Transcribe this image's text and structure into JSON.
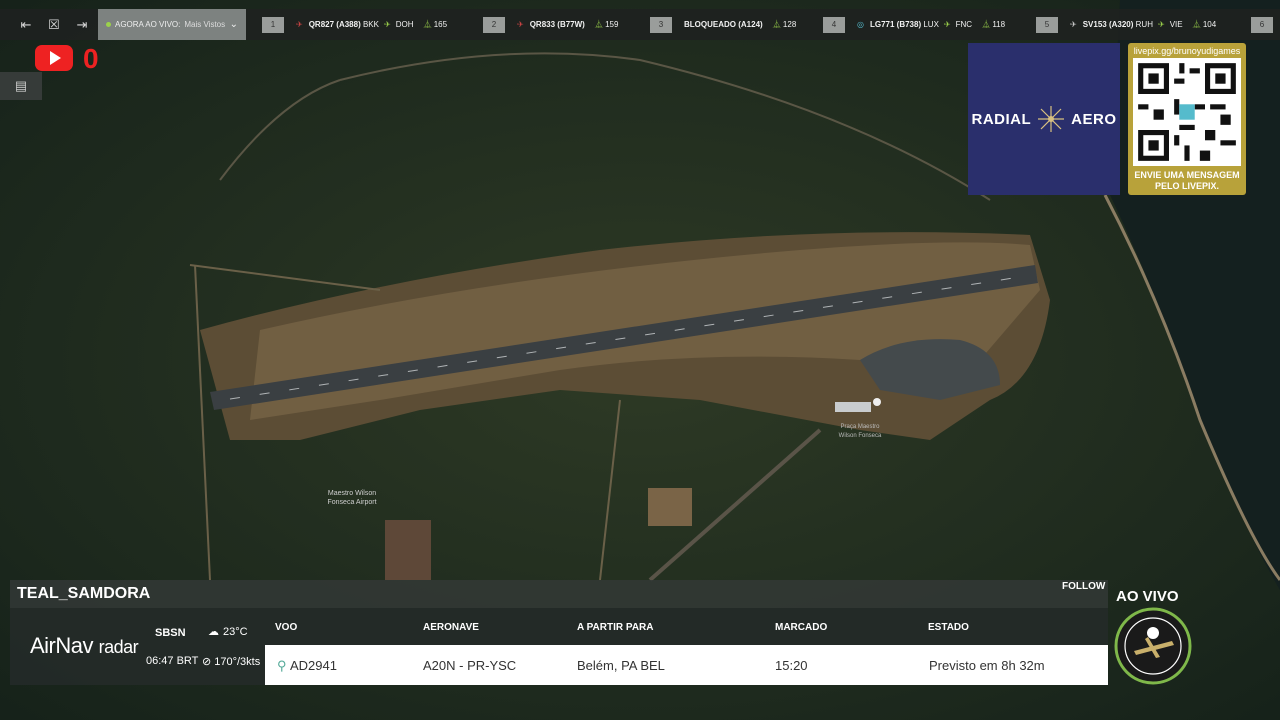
{
  "topbar": {
    "live_label": "AGORA AO VIVO:",
    "live_value": "Mais Vistos",
    "flights": [
      {
        "num": "1",
        "code": "QR827 (A388)",
        "from": "BKK",
        "to": "DOH",
        "count": "165"
      },
      {
        "num": "2",
        "code": "QR833 (B77W)",
        "from": "",
        "to": "",
        "count": "159"
      },
      {
        "num": "3",
        "code": "BLOQUEADO (A124)",
        "from": "",
        "to": "",
        "count": "128"
      },
      {
        "num": "4",
        "code": "LG771 (B738)",
        "from": "LUX",
        "to": "FNC",
        "count": "118"
      },
      {
        "num": "5",
        "code": "SV153 (A320)",
        "from": "RUH",
        "to": "VIE",
        "count": "104"
      },
      {
        "num": "6",
        "code": "",
        "from": "",
        "to": "",
        "count": ""
      }
    ]
  },
  "youtube": {
    "count": "0"
  },
  "sponsor": {
    "left": "RADIAL",
    "right": "AERO"
  },
  "qr": {
    "url": "livepix.gg/brunoyudigames",
    "message": "ENVIE UMA MENSAGEM PELO LIVEPIX."
  },
  "map_labels": {
    "airport": "Maestro Wilson Fonseca Airport",
    "plaza": "Praça Maestro Wilson Fonseca"
  },
  "panel": {
    "callsign": "TEAL_SAMDORA",
    "follow": "FOLLOW",
    "logo_air": "AirNav",
    "logo_radar": "radar",
    "airport_code": "SBSN",
    "local_time": "06:47 BRT",
    "temperature": "23°C",
    "wind": "170°/3kts",
    "headers": {
      "voo": "VOO",
      "aeronave": "AERONAVE",
      "partir": "A PARTIR PARA",
      "marcado": "MARCADO",
      "estado": "ESTADO"
    },
    "flight": {
      "voo": "AD2941",
      "aeronave": "A20N - PR-YSC",
      "partir": "Belém, PA BEL",
      "marcado": "15:20",
      "estado": "Previsto em 8h 32m"
    }
  },
  "live_label": "AO VIVO",
  "colors": {
    "accent_green": "#9bd14b",
    "youtube_red": "#e22222",
    "sponsor_blue": "#2a2f6c",
    "qr_gold": "#b8a23a"
  }
}
